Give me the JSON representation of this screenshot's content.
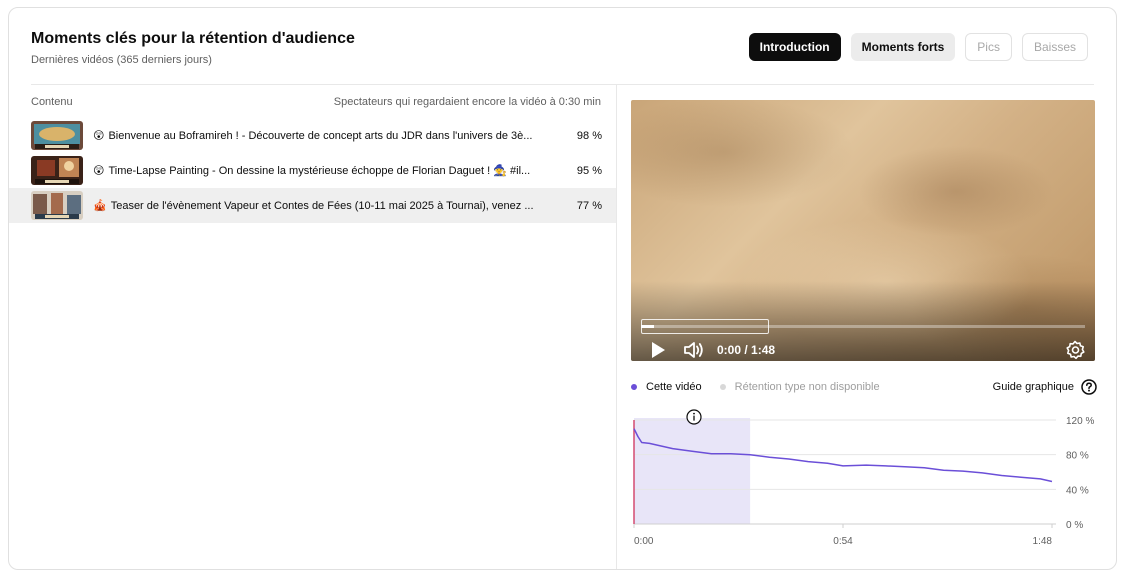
{
  "card": {
    "title": "Moments clés pour la rétention d'audience",
    "subtitle": "Dernières vidéos (365 derniers jours)"
  },
  "tabs": [
    {
      "label": "Introduction",
      "state": "active"
    },
    {
      "label": "Moments forts",
      "state": "normal"
    },
    {
      "label": "Pics",
      "state": "disabled"
    },
    {
      "label": "Baisses",
      "state": "disabled"
    }
  ],
  "list": {
    "col_content": "Contenu",
    "col_metric": "Spectateurs qui regardaient encore la vidéo à 0:30 min",
    "rows": [
      {
        "emoji": "😲",
        "title": "Bienvenue au Boframireh ! - Découverte de concept arts du JDR dans l'univers de 3è...",
        "value": "98 %",
        "selected": false
      },
      {
        "emoji": "😲",
        "title": "Time-Lapse Painting - On dessine la mystérieuse échoppe de Florian Daguet ! 🧙 #il...",
        "value": "95 %",
        "selected": false
      },
      {
        "emoji": "🎪",
        "title": "Teaser de l'évènement Vapeur et Contes de Fées (10-11 mai 2025 à Tournai), venez ...",
        "value": "77 %",
        "selected": true
      }
    ]
  },
  "player": {
    "time": "0:00 / 1:48",
    "progress": 0.03
  },
  "legend": {
    "this_video": "Cette vidéo",
    "typical": "Rétention type non disponible",
    "guide": "Guide graphique"
  },
  "colors": {
    "series": "#6b4fd8",
    "highlight": "#e8e5f8",
    "start_marker": "#d44a70",
    "active_tab": "#0d0d0d"
  },
  "chart_data": {
    "type": "line",
    "series": [
      {
        "name": "Cette vidéo",
        "x": [
          0,
          1,
          2,
          4,
          6,
          10,
          15,
          20,
          25,
          30,
          35,
          40,
          45,
          50,
          54,
          60,
          65,
          70,
          75,
          80,
          85,
          90,
          95,
          100,
          105,
          108
        ],
        "values": [
          110,
          101,
          94,
          93,
          91,
          87,
          84,
          81,
          81,
          80,
          77,
          75,
          72,
          70,
          67,
          68,
          67,
          66,
          65,
          62,
          61,
          59,
          56,
          54,
          52,
          49
        ]
      }
    ],
    "x_tick_labels": [
      "0:00",
      "0:54",
      "1:48"
    ],
    "x_ticks": [
      0,
      54,
      108
    ],
    "y_tick_labels": [
      "120 %",
      "80 %",
      "40 %",
      "0 %"
    ],
    "y_ticks": [
      120,
      80,
      40,
      0
    ],
    "xlim": [
      0,
      108
    ],
    "ylim": [
      0,
      120
    ],
    "highlight_range": [
      0,
      30
    ],
    "grid": true
  }
}
